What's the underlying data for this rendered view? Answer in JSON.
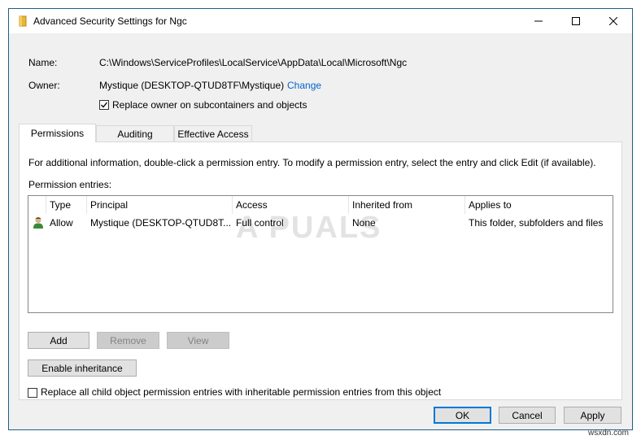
{
  "window": {
    "title": "Advanced Security Settings for Ngc"
  },
  "fields": {
    "name_label": "Name:",
    "name_value": "C:\\Windows\\ServiceProfiles\\LocalService\\AppData\\Local\\Microsoft\\Ngc",
    "owner_label": "Owner:",
    "owner_value": "Mystique (DESKTOP-QTUD8TF\\Mystique)",
    "change_link": "Change",
    "replace_owner_label": "Replace owner on subcontainers and objects",
    "replace_owner_checked": true
  },
  "tabs": [
    {
      "label": "Permissions",
      "active": true
    },
    {
      "label": "Auditing",
      "active": false
    },
    {
      "label": "Effective Access",
      "active": false
    }
  ],
  "permissions": {
    "info_text": "For additional information, double-click a permission entry. To modify a permission entry, select the entry and click Edit (if available).",
    "entries_label": "Permission entries:",
    "columns": [
      "Type",
      "Principal",
      "Access",
      "Inherited from",
      "Applies to"
    ],
    "rows": [
      {
        "type": "Allow",
        "principal": "Mystique (DESKTOP-QTUD8T...",
        "access": "Full control",
        "inherited_from": "None",
        "applies_to": "This folder, subfolders and files",
        "icon": "user-icon"
      }
    ],
    "watermark": "A PUALS"
  },
  "buttons": {
    "add": "Add",
    "remove": "Remove",
    "view": "View",
    "enable_inheritance": "Enable inheritance",
    "replace_child_label": "Replace all child object permission entries with inheritable permission entries from this object",
    "replace_child_checked": false,
    "ok": "OK",
    "cancel": "Cancel",
    "apply": "Apply"
  },
  "footer": {
    "site": "wsxdn.com"
  }
}
